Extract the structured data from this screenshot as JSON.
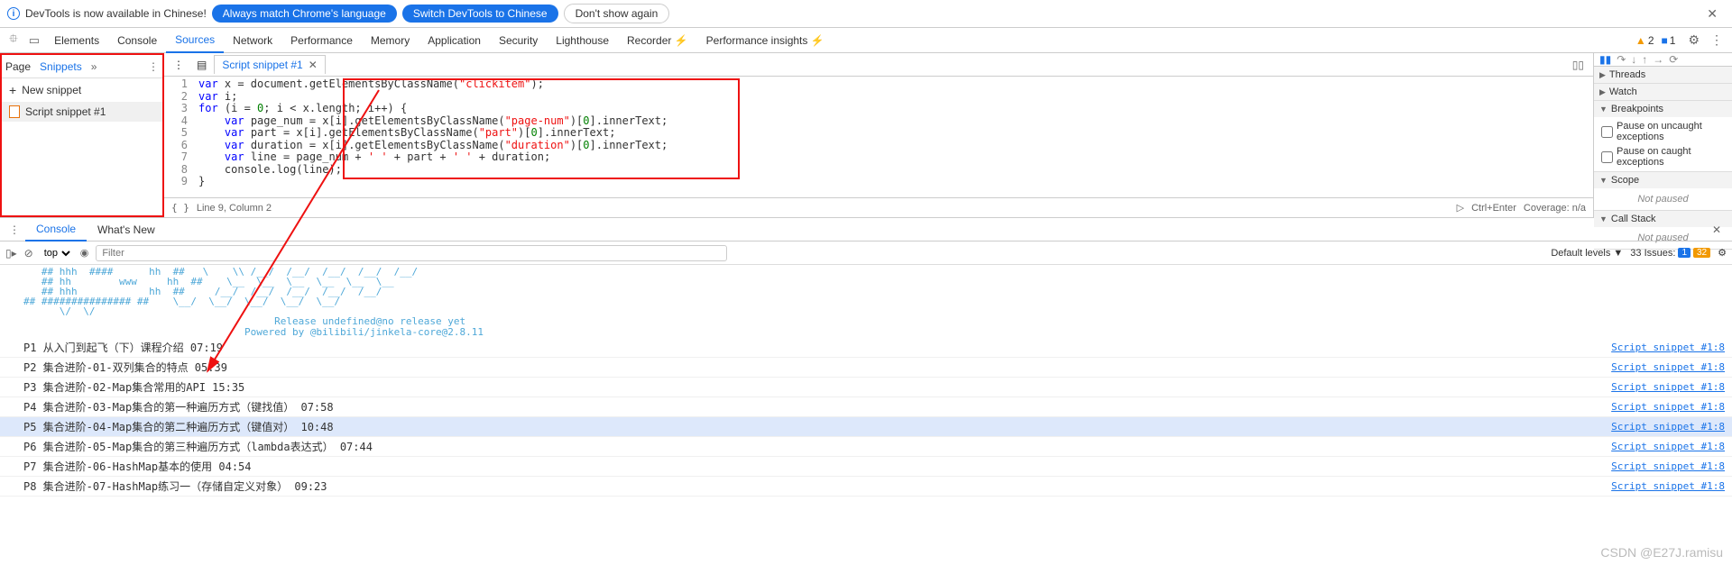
{
  "infobar": {
    "text": "DevTools is now available in Chinese!",
    "btn1": "Always match Chrome's language",
    "btn2": "Switch DevTools to Chinese",
    "btn3": "Don't show again"
  },
  "tabs": {
    "items": [
      "Elements",
      "Console",
      "Sources",
      "Network",
      "Performance",
      "Memory",
      "Application",
      "Security",
      "Lighthouse",
      "Recorder ⚡",
      "Performance insights ⚡"
    ],
    "active_index": 2,
    "warnings_count": "2",
    "issues_count": "1"
  },
  "left": {
    "page": "Page",
    "snippets": "Snippets",
    "new": "New snippet",
    "item": "Script snippet #1"
  },
  "code": {
    "file_tab": "Script snippet #1",
    "lines": [
      {
        "n": "1",
        "indent": 0,
        "tokens": [
          [
            "kw",
            "var"
          ],
          [
            "pln",
            " x = document.getElementsByClassName("
          ],
          [
            "str",
            "\"clickitem\""
          ],
          [
            "pln",
            ");"
          ]
        ]
      },
      {
        "n": "2",
        "indent": 0,
        "tokens": [
          [
            "kw",
            "var"
          ],
          [
            "pln",
            " i;"
          ]
        ]
      },
      {
        "n": "3",
        "indent": 0,
        "tokens": [
          [
            "kw",
            "for"
          ],
          [
            "pln",
            " (i = "
          ],
          [
            "num",
            "0"
          ],
          [
            "pln",
            "; i < x.length; i++) {"
          ]
        ]
      },
      {
        "n": "4",
        "indent": 1,
        "tokens": [
          [
            "kw",
            "var"
          ],
          [
            "pln",
            " page_num = x[i].getElementsByClassName("
          ],
          [
            "str",
            "\"page-num\""
          ],
          [
            "pln",
            ")["
          ],
          [
            "num",
            "0"
          ],
          [
            "pln",
            "].innerText;"
          ]
        ]
      },
      {
        "n": "5",
        "indent": 1,
        "tokens": [
          [
            "kw",
            "var"
          ],
          [
            "pln",
            " part = x[i].getElementsByClassName("
          ],
          [
            "str",
            "\"part\""
          ],
          [
            "pln",
            ")["
          ],
          [
            "num",
            "0"
          ],
          [
            "pln",
            "].innerText;"
          ]
        ]
      },
      {
        "n": "6",
        "indent": 1,
        "tokens": [
          [
            "kw",
            "var"
          ],
          [
            "pln",
            " duration = x[i].getElementsByClassName("
          ],
          [
            "str",
            "\"duration\""
          ],
          [
            "pln",
            ")["
          ],
          [
            "num",
            "0"
          ],
          [
            "pln",
            "].innerText;"
          ]
        ]
      },
      {
        "n": "7",
        "indent": 1,
        "tokens": [
          [
            "kw",
            "var"
          ],
          [
            "pln",
            " line = page_num + "
          ],
          [
            "str",
            "' '"
          ],
          [
            "pln",
            " + part + "
          ],
          [
            "str",
            "' '"
          ],
          [
            "pln",
            " + duration;"
          ]
        ]
      },
      {
        "n": "8",
        "indent": 1,
        "tokens": [
          [
            "pln",
            "console.log(line);"
          ]
        ]
      },
      {
        "n": "9",
        "indent": 0,
        "tokens": [
          [
            "pln",
            "}"
          ]
        ]
      }
    ],
    "status": "Line 9, Column 2",
    "shortcut": "Ctrl+Enter",
    "coverage": "Coverage: n/a"
  },
  "right": {
    "threads": "Threads",
    "watch": "Watch",
    "bp": "Breakpoints",
    "cb1": "Pause on uncaught exceptions",
    "cb2": "Pause on caught exceptions",
    "scope": "Scope",
    "np": "Not paused",
    "cs": "Call Stack"
  },
  "drawer": {
    "console": "Console",
    "whatsnew": "What's New"
  },
  "ctb": {
    "ctx": "top",
    "filter_ph": "Filter",
    "levels": "Default levels ▼",
    "issues_label": "33 Issues:",
    "b1": "1",
    "b2": "32"
  },
  "console_ascii": "   ## hhh  ####      hh  ##   \\    \\\\ /__/  /__/  /__/  /__/  /__/\n   ## hh        www     hh  ##    \\__  \\__  \\__  \\__  \\__  \\__\n   ## hhh            hh  ##     /__/  /__/  /__/  /__/  /__/\n## ############### ##    \\__/  \\__/  \\__/  \\__/  \\__/\n      \\/  \\/",
  "console_release": "                                          Release undefined@no release yet\n                                     Powered by @bilibili/jinkela-core@2.8.11",
  "console_rows": [
    {
      "msg": "P1 从入门到起飞（下）课程介绍 07:19",
      "src": "Script snippet #1:8",
      "hl": false
    },
    {
      "msg": "P2 集合进阶-01-双列集合的特点 05:39",
      "src": "Script snippet #1:8",
      "hl": false
    },
    {
      "msg": "P3 集合进阶-02-Map集合常用的API 15:35",
      "src": "Script snippet #1:8",
      "hl": false
    },
    {
      "msg": "P4 集合进阶-03-Map集合的第一种遍历方式（键找值） 07:58",
      "src": "Script snippet #1:8",
      "hl": false
    },
    {
      "msg": "P5 集合进阶-04-Map集合的第二种遍历方式（键值对） 10:48",
      "src": "Script snippet #1:8",
      "hl": true
    },
    {
      "msg": "P6 集合进阶-05-Map集合的第三种遍历方式（lambda表达式） 07:44",
      "src": "Script snippet #1:8",
      "hl": false
    },
    {
      "msg": "P7 集合进阶-06-HashMap基本的使用 04:54",
      "src": "Script snippet #1:8",
      "hl": false
    },
    {
      "msg": "P8 集合进阶-07-HashMap练习一（存储自定义对象） 09:23",
      "src": "Script snippet #1:8",
      "hl": false
    }
  ],
  "watermark": "CSDN @E27J.ramisu"
}
